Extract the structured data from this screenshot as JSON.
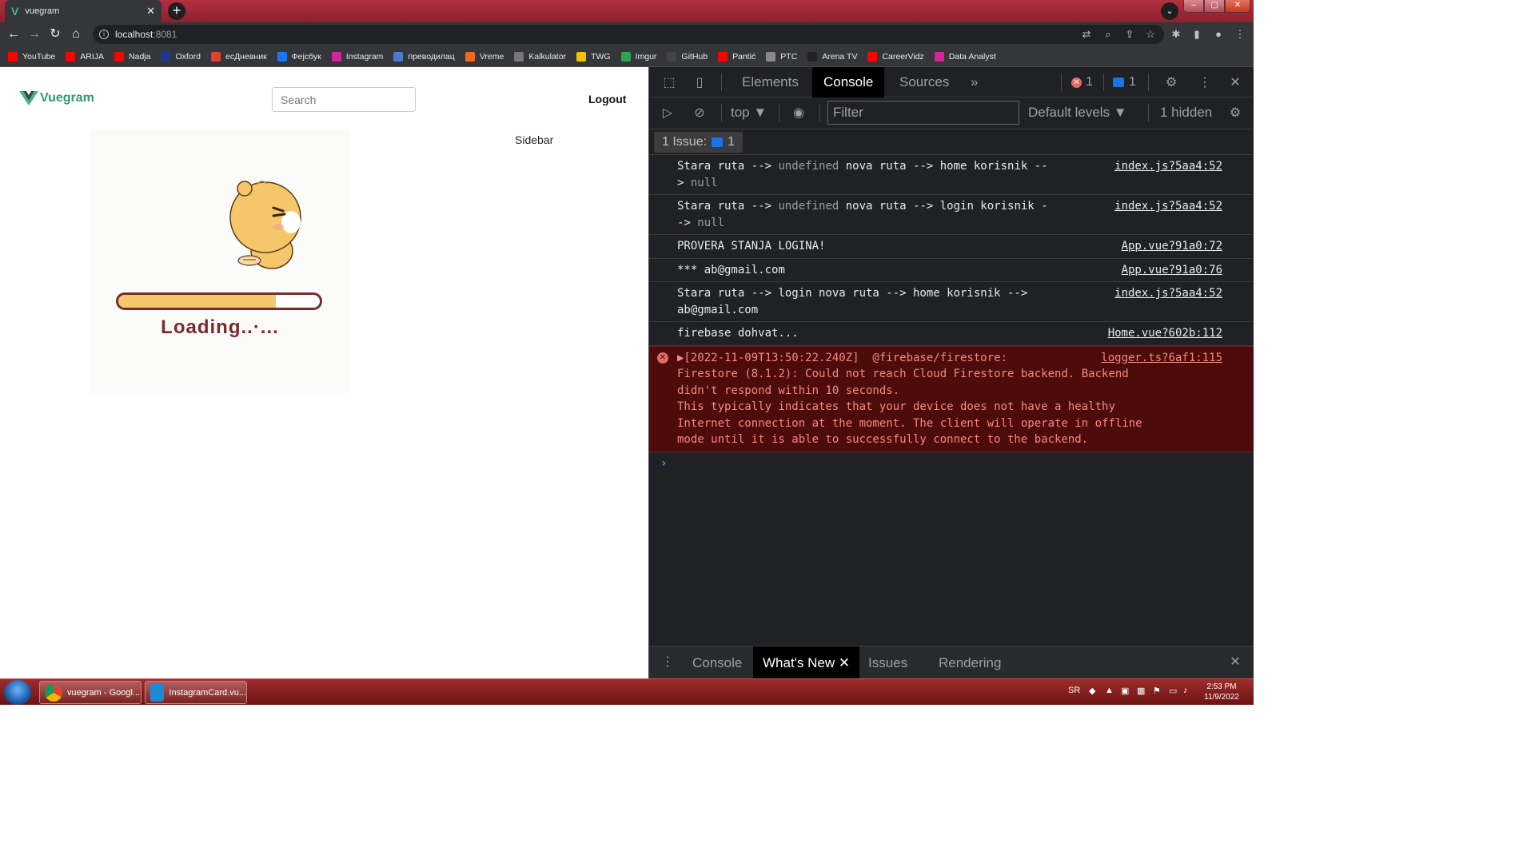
{
  "browser": {
    "tab_title": "vuegram",
    "url_host": "localhost",
    "url_port": ":8081",
    "bookmarks": [
      {
        "label": "YouTube",
        "color": "#ff0000"
      },
      {
        "label": "ARIJA",
        "color": "#ff0000"
      },
      {
        "label": "Nadja",
        "color": "#ff0000"
      },
      {
        "label": "Oxford",
        "color": "#1a3b8c"
      },
      {
        "label": "есДневник",
        "color": "#e0412b"
      },
      {
        "label": "Фејсбук",
        "color": "#1877f2"
      },
      {
        "label": "Instagram",
        "color": "#d6249f"
      },
      {
        "label": "преводилац",
        "color": "#4a7bd0"
      },
      {
        "label": "Vreme",
        "color": "#f06a1d"
      },
      {
        "label": "Kalkulator",
        "color": "#777777"
      },
      {
        "label": "TWG",
        "color": "#f2c200"
      },
      {
        "label": "Imgur",
        "color": "#2ea44f"
      },
      {
        "label": "GitHub",
        "color": "#444444"
      },
      {
        "label": "Pantić",
        "color": "#ff0000"
      },
      {
        "label": "PTC",
        "color": "#888888"
      },
      {
        "label": "Arena TV",
        "color": "#222222"
      },
      {
        "label": "CareerVidz",
        "color": "#ff0000"
      },
      {
        "label": "Data Analyst",
        "color": "#d6249f"
      }
    ]
  },
  "app": {
    "brand": "Vuegram",
    "search_placeholder": "Search",
    "logout": "Logout",
    "sidebar": "Sidebar",
    "loading_text": "Loading..·...",
    "loading_progress": 0.78,
    "brand_color": "#41b883"
  },
  "devtools": {
    "tabs": [
      "Elements",
      "Console",
      "Sources"
    ],
    "active_tab": "Console",
    "more": "»",
    "error_count": "1",
    "message_count": "1",
    "context": "top",
    "filter_placeholder": "Filter",
    "levels": "Default levels",
    "hidden": "1 hidden",
    "issues_label": "1 Issue:",
    "issues_count": "1",
    "logs": [
      {
        "pre": "Stara ruta --> ",
        "muted": "undefined",
        "post": " nova ruta --> home korisnik --\n> ",
        "tail": "null",
        "src": "index.js?5aa4:52"
      },
      {
        "pre": "Stara ruta --> ",
        "muted": "undefined",
        "post": " nova ruta --> login korisnik -\n-> ",
        "tail": "null",
        "src": "index.js?5aa4:52"
      },
      {
        "pre": "PROVERA STANJA LOGINA!",
        "muted": "",
        "post": "",
        "tail": "",
        "src": "App.vue?91a0:72"
      },
      {
        "pre": "*** ab@gmail.com",
        "muted": "",
        "post": "",
        "tail": "",
        "src": "App.vue?91a0:76"
      },
      {
        "pre": "Stara ruta --> login nova ruta --> home korisnik -->\nab@gmail.com",
        "muted": "",
        "post": "",
        "tail": "",
        "src": "index.js?5aa4:52"
      },
      {
        "pre": "firebase dohvat...",
        "muted": "",
        "post": "",
        "tail": "",
        "src": "Home.vue?602b:112"
      }
    ],
    "error": {
      "text": "▶[2022-11-09T13:50:22.240Z]  @firebase/firestore:\nFirestore (8.1.2): Could not reach Cloud Firestore backend. Backend\ndidn't respond within 10 seconds.\nThis typically indicates that your device does not have a healthy\nInternet connection at the moment. The client will operate in offline\nmode until it is able to successfully connect to the backend.",
      "src": "logger.ts?6af1:115"
    },
    "drawer_tabs": [
      "Console",
      "What's New",
      "Issues",
      "Rendering"
    ],
    "drawer_active": "What's New"
  },
  "taskbar": {
    "items": [
      {
        "label": "vuegram - Googl..."
      },
      {
        "label": "InstagramCard.vu..."
      }
    ],
    "lang": "SR",
    "time": "2:53 PM",
    "date": "11/9/2022"
  }
}
